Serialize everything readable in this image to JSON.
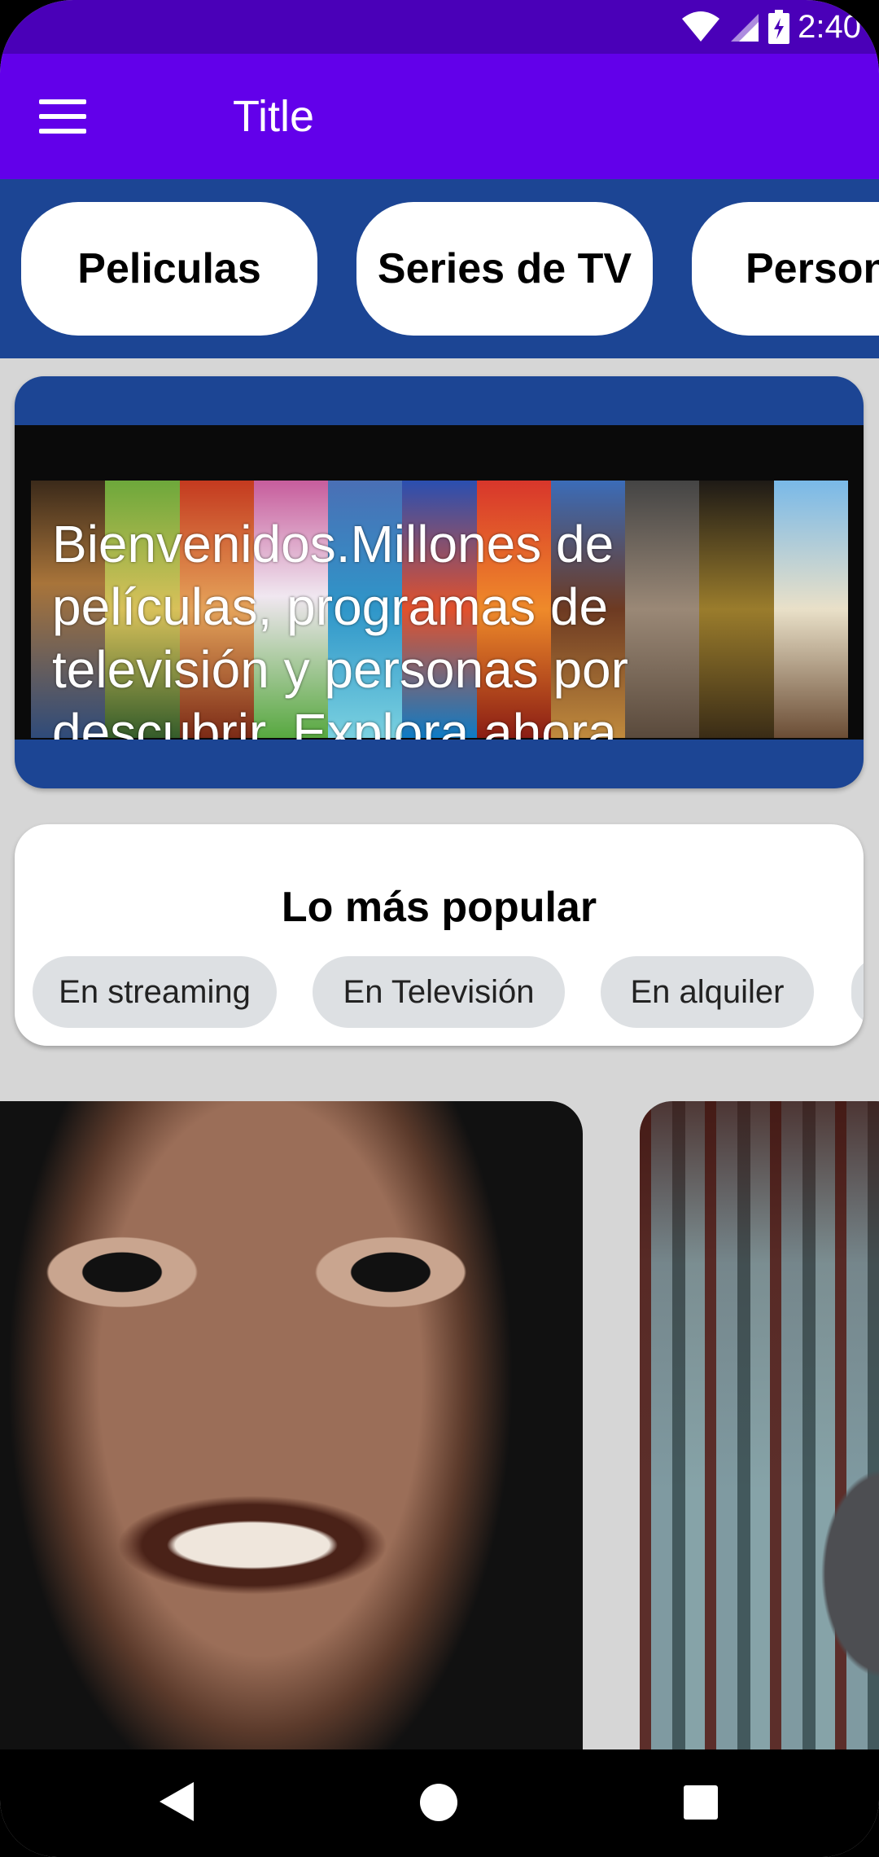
{
  "status_bar": {
    "time": "2:40",
    "icons": [
      "wifi-icon",
      "signal-icon",
      "battery-charging-icon"
    ]
  },
  "app_bar": {
    "title": "Title",
    "menu_icon": "hamburger-menu-icon"
  },
  "categories": [
    {
      "label": "Peliculas"
    },
    {
      "label": "Series de TV"
    },
    {
      "label": "Personas"
    }
  ],
  "welcome": {
    "text": "Bienvenidos.Millones de películas, programas de televisión y personas por descubrir. Explora ahora."
  },
  "popular": {
    "title": "Lo más popular",
    "chips": [
      {
        "label": "En streaming"
      },
      {
        "label": "En Televisión"
      },
      {
        "label": "En alquiler"
      }
    ]
  },
  "navigation": {
    "buttons": [
      "back",
      "home",
      "recents"
    ]
  },
  "colors": {
    "status_bar": "#4a00b8",
    "app_bar": "#6200ea",
    "category_strip": "#1c4594",
    "chip_background": "#dde0e3"
  }
}
